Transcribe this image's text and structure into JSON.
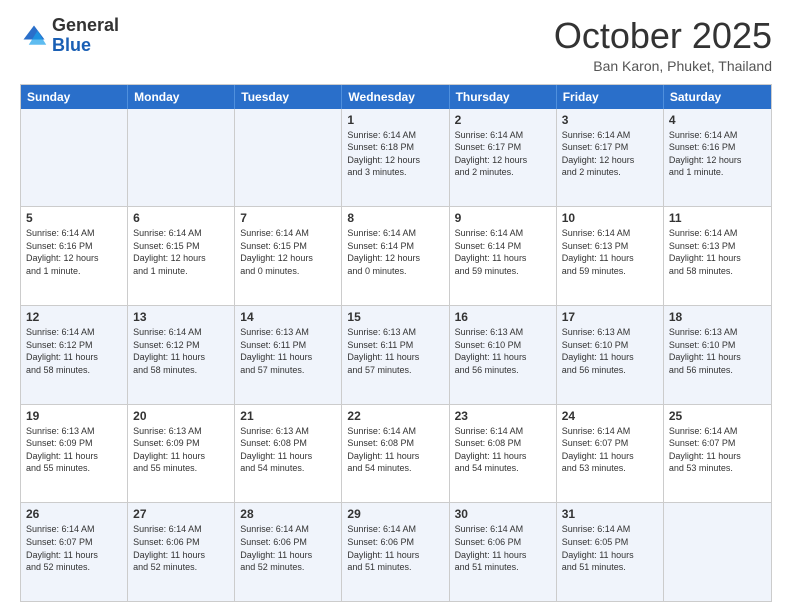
{
  "header": {
    "logo_general": "General",
    "logo_blue": "Blue",
    "month_title": "October 2025",
    "subtitle": "Ban Karon, Phuket, Thailand"
  },
  "weekdays": [
    "Sunday",
    "Monday",
    "Tuesday",
    "Wednesday",
    "Thursday",
    "Friday",
    "Saturday"
  ],
  "rows": [
    [
      {
        "day": "",
        "text": ""
      },
      {
        "day": "",
        "text": ""
      },
      {
        "day": "",
        "text": ""
      },
      {
        "day": "1",
        "text": "Sunrise: 6:14 AM\nSunset: 6:18 PM\nDaylight: 12 hours\nand 3 minutes."
      },
      {
        "day": "2",
        "text": "Sunrise: 6:14 AM\nSunset: 6:17 PM\nDaylight: 12 hours\nand 2 minutes."
      },
      {
        "day": "3",
        "text": "Sunrise: 6:14 AM\nSunset: 6:17 PM\nDaylight: 12 hours\nand 2 minutes."
      },
      {
        "day": "4",
        "text": "Sunrise: 6:14 AM\nSunset: 6:16 PM\nDaylight: 12 hours\nand 1 minute."
      }
    ],
    [
      {
        "day": "5",
        "text": "Sunrise: 6:14 AM\nSunset: 6:16 PM\nDaylight: 12 hours\nand 1 minute."
      },
      {
        "day": "6",
        "text": "Sunrise: 6:14 AM\nSunset: 6:15 PM\nDaylight: 12 hours\nand 1 minute."
      },
      {
        "day": "7",
        "text": "Sunrise: 6:14 AM\nSunset: 6:15 PM\nDaylight: 12 hours\nand 0 minutes."
      },
      {
        "day": "8",
        "text": "Sunrise: 6:14 AM\nSunset: 6:14 PM\nDaylight: 12 hours\nand 0 minutes."
      },
      {
        "day": "9",
        "text": "Sunrise: 6:14 AM\nSunset: 6:14 PM\nDaylight: 11 hours\nand 59 minutes."
      },
      {
        "day": "10",
        "text": "Sunrise: 6:14 AM\nSunset: 6:13 PM\nDaylight: 11 hours\nand 59 minutes."
      },
      {
        "day": "11",
        "text": "Sunrise: 6:14 AM\nSunset: 6:13 PM\nDaylight: 11 hours\nand 58 minutes."
      }
    ],
    [
      {
        "day": "12",
        "text": "Sunrise: 6:14 AM\nSunset: 6:12 PM\nDaylight: 11 hours\nand 58 minutes."
      },
      {
        "day": "13",
        "text": "Sunrise: 6:14 AM\nSunset: 6:12 PM\nDaylight: 11 hours\nand 58 minutes."
      },
      {
        "day": "14",
        "text": "Sunrise: 6:13 AM\nSunset: 6:11 PM\nDaylight: 11 hours\nand 57 minutes."
      },
      {
        "day": "15",
        "text": "Sunrise: 6:13 AM\nSunset: 6:11 PM\nDaylight: 11 hours\nand 57 minutes."
      },
      {
        "day": "16",
        "text": "Sunrise: 6:13 AM\nSunset: 6:10 PM\nDaylight: 11 hours\nand 56 minutes."
      },
      {
        "day": "17",
        "text": "Sunrise: 6:13 AM\nSunset: 6:10 PM\nDaylight: 11 hours\nand 56 minutes."
      },
      {
        "day": "18",
        "text": "Sunrise: 6:13 AM\nSunset: 6:10 PM\nDaylight: 11 hours\nand 56 minutes."
      }
    ],
    [
      {
        "day": "19",
        "text": "Sunrise: 6:13 AM\nSunset: 6:09 PM\nDaylight: 11 hours\nand 55 minutes."
      },
      {
        "day": "20",
        "text": "Sunrise: 6:13 AM\nSunset: 6:09 PM\nDaylight: 11 hours\nand 55 minutes."
      },
      {
        "day": "21",
        "text": "Sunrise: 6:13 AM\nSunset: 6:08 PM\nDaylight: 11 hours\nand 54 minutes."
      },
      {
        "day": "22",
        "text": "Sunrise: 6:14 AM\nSunset: 6:08 PM\nDaylight: 11 hours\nand 54 minutes."
      },
      {
        "day": "23",
        "text": "Sunrise: 6:14 AM\nSunset: 6:08 PM\nDaylight: 11 hours\nand 54 minutes."
      },
      {
        "day": "24",
        "text": "Sunrise: 6:14 AM\nSunset: 6:07 PM\nDaylight: 11 hours\nand 53 minutes."
      },
      {
        "day": "25",
        "text": "Sunrise: 6:14 AM\nSunset: 6:07 PM\nDaylight: 11 hours\nand 53 minutes."
      }
    ],
    [
      {
        "day": "26",
        "text": "Sunrise: 6:14 AM\nSunset: 6:07 PM\nDaylight: 11 hours\nand 52 minutes."
      },
      {
        "day": "27",
        "text": "Sunrise: 6:14 AM\nSunset: 6:06 PM\nDaylight: 11 hours\nand 52 minutes."
      },
      {
        "day": "28",
        "text": "Sunrise: 6:14 AM\nSunset: 6:06 PM\nDaylight: 11 hours\nand 52 minutes."
      },
      {
        "day": "29",
        "text": "Sunrise: 6:14 AM\nSunset: 6:06 PM\nDaylight: 11 hours\nand 51 minutes."
      },
      {
        "day": "30",
        "text": "Sunrise: 6:14 AM\nSunset: 6:06 PM\nDaylight: 11 hours\nand 51 minutes."
      },
      {
        "day": "31",
        "text": "Sunrise: 6:14 AM\nSunset: 6:05 PM\nDaylight: 11 hours\nand 51 minutes."
      },
      {
        "day": "",
        "text": ""
      }
    ]
  ],
  "alt_rows": [
    0,
    2,
    4
  ]
}
